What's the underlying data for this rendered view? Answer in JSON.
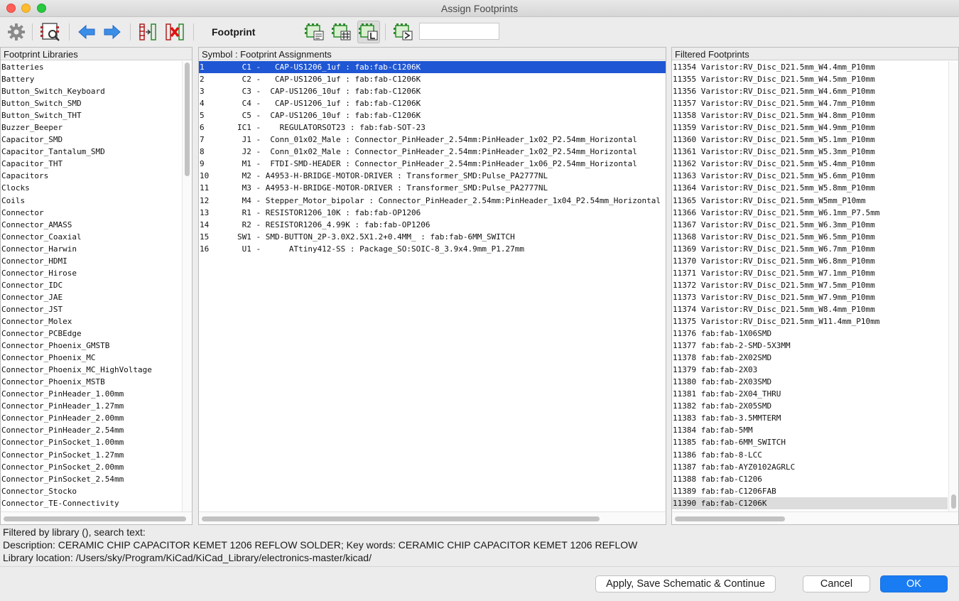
{
  "window": {
    "title": "Assign Footprints"
  },
  "toolbar": {
    "label": "Footprint",
    "filter_value": "",
    "icons": [
      "gear-icon",
      "footprint-viewer-icon",
      "arrow-left-icon",
      "arrow-right-icon",
      "auto-associate-icon",
      "delete-associations-icon",
      "filter-by-keywords-icon",
      "filter-by-pin-count-icon",
      "filter-by-library-icon",
      "filter-by-text-icon"
    ]
  },
  "libraries": {
    "header": "Footprint Libraries",
    "items": [
      "Batteries",
      "Battery",
      "Button_Switch_Keyboard",
      "Button_Switch_SMD",
      "Button_Switch_THT",
      "Buzzer_Beeper",
      "Capacitor_SMD",
      "Capacitor_Tantalum_SMD",
      "Capacitor_THT",
      "Capacitors",
      "Clocks",
      "Coils",
      "Connector",
      "Connector_AMASS",
      "Connector_Coaxial",
      "Connector_Harwin",
      "Connector_HDMI",
      "Connector_Hirose",
      "Connector_IDC",
      "Connector_JAE",
      "Connector_JST",
      "Connector_Molex",
      "Connector_PCBEdge",
      "Connector_Phoenix_GMSTB",
      "Connector_Phoenix_MC",
      "Connector_Phoenix_MC_HighVoltage",
      "Connector_Phoenix_MSTB",
      "Connector_PinHeader_1.00mm",
      "Connector_PinHeader_1.27mm",
      "Connector_PinHeader_2.00mm",
      "Connector_PinHeader_2.54mm",
      "Connector_PinSocket_1.00mm",
      "Connector_PinSocket_1.27mm",
      "Connector_PinSocket_2.00mm",
      "Connector_PinSocket_2.54mm",
      "Connector_Stocko",
      "Connector_TE-Connectivity"
    ]
  },
  "assignments": {
    "header": "Symbol : Footprint Assignments",
    "items": [
      "1        C1 -   CAP-US1206_1uf : fab:fab-C1206K",
      "2        C2 -   CAP-US1206_1uf : fab:fab-C1206K",
      "3        C3 -  CAP-US1206_10uf : fab:fab-C1206K",
      "4        C4 -   CAP-US1206_1uf : fab:fab-C1206K",
      "5        C5 -  CAP-US1206_10uf : fab:fab-C1206K",
      "6       IC1 -    REGULATORSOT23 : fab:fab-SOT-23",
      "7        J1 -  Conn_01x02_Male : Connector_PinHeader_2.54mm:PinHeader_1x02_P2.54mm_Horizontal",
      "8        J2 -  Conn_01x02_Male : Connector_PinHeader_2.54mm:PinHeader_1x02_P2.54mm_Horizontal",
      "9        M1 -  FTDI-SMD-HEADER : Connector_PinHeader_2.54mm:PinHeader_1x06_P2.54mm_Horizontal",
      "10       M2 - A4953-H-BRIDGE-MOTOR-DRIVER : Transformer_SMD:Pulse_PA2777NL",
      "11       M3 - A4953-H-BRIDGE-MOTOR-DRIVER : Transformer_SMD:Pulse_PA2777NL",
      "12       M4 - Stepper_Motor_bipolar : Connector_PinHeader_2.54mm:PinHeader_1x04_P2.54mm_Horizontal",
      "13       R1 - RESISTOR1206_10K : fab:fab-OP1206",
      "14       R2 - RESISTOR1206_4.99K : fab:fab-OP1206",
      "15      SW1 - SMD-BUTTON_2P-3.0X2.5X1.2+0.4MM_ : fab:fab-6MM_SWITCH",
      "16       U1 -      ATtiny412-SS : Package_SO:SOIC-8_3.9x4.9mm_P1.27mm"
    ]
  },
  "filtered": {
    "header": "Filtered Footprints",
    "items": [
      "11354 Varistor:RV_Disc_D21.5mm_W4.4mm_P10mm",
      "11355 Varistor:RV_Disc_D21.5mm_W4.5mm_P10mm",
      "11356 Varistor:RV_Disc_D21.5mm_W4.6mm_P10mm",
      "11357 Varistor:RV_Disc_D21.5mm_W4.7mm_P10mm",
      "11358 Varistor:RV_Disc_D21.5mm_W4.8mm_P10mm",
      "11359 Varistor:RV_Disc_D21.5mm_W4.9mm_P10mm",
      "11360 Varistor:RV_Disc_D21.5mm_W5.1mm_P10mm",
      "11361 Varistor:RV_Disc_D21.5mm_W5.3mm_P10mm",
      "11362 Varistor:RV_Disc_D21.5mm_W5.4mm_P10mm",
      "11363 Varistor:RV_Disc_D21.5mm_W5.6mm_P10mm",
      "11364 Varistor:RV_Disc_D21.5mm_W5.8mm_P10mm",
      "11365 Varistor:RV_Disc_D21.5mm_W5mm_P10mm",
      "11366 Varistor:RV_Disc_D21.5mm_W6.1mm_P7.5mm",
      "11367 Varistor:RV_Disc_D21.5mm_W6.3mm_P10mm",
      "11368 Varistor:RV_Disc_D21.5mm_W6.5mm_P10mm",
      "11369 Varistor:RV_Disc_D21.5mm_W6.7mm_P10mm",
      "11370 Varistor:RV_Disc_D21.5mm_W6.8mm_P10mm",
      "11371 Varistor:RV_Disc_D21.5mm_W7.1mm_P10mm",
      "11372 Varistor:RV_Disc_D21.5mm_W7.5mm_P10mm",
      "11373 Varistor:RV_Disc_D21.5mm_W7.9mm_P10mm",
      "11374 Varistor:RV_Disc_D21.5mm_W8.4mm_P10mm",
      "11375 Varistor:RV_Disc_D21.5mm_W11.4mm_P10mm",
      "11376 fab:fab-1X06SMD",
      "11377 fab:fab-2-SMD-5X3MM",
      "11378 fab:fab-2X02SMD",
      "11379 fab:fab-2X03",
      "11380 fab:fab-2X03SMD",
      "11381 fab:fab-2X04_THRU",
      "11382 fab:fab-2X05SMD",
      "11383 fab:fab-3.5MMTERM",
      "11384 fab:fab-5MM",
      "11385 fab:fab-6MM_SWITCH",
      "11386 fab:fab-8-LCC",
      "11387 fab:fab-AYZ0102AGRLC",
      "11388 fab:fab-C1206",
      "11389 fab:fab-C1206FAB",
      "11390 fab:fab-C1206K"
    ]
  },
  "status": {
    "filter": "Filtered by library (), search text:",
    "description": "Description: CERAMIC CHIP CAPACITOR KEMET 1206 REFLOW SOLDER;  Key words: CERAMIC CHIP CAPACITOR KEMET 1206 REFLOW",
    "location": "Library location: /Users/sky/Program/KiCad/KiCad_Library/electronics-master/kicad/"
  },
  "buttons": {
    "apply": "Apply, Save Schematic & Continue",
    "cancel": "Cancel",
    "ok": "OK"
  },
  "colors": {
    "selection": "#1f56d3",
    "primary_button": "#1a7cf2"
  }
}
